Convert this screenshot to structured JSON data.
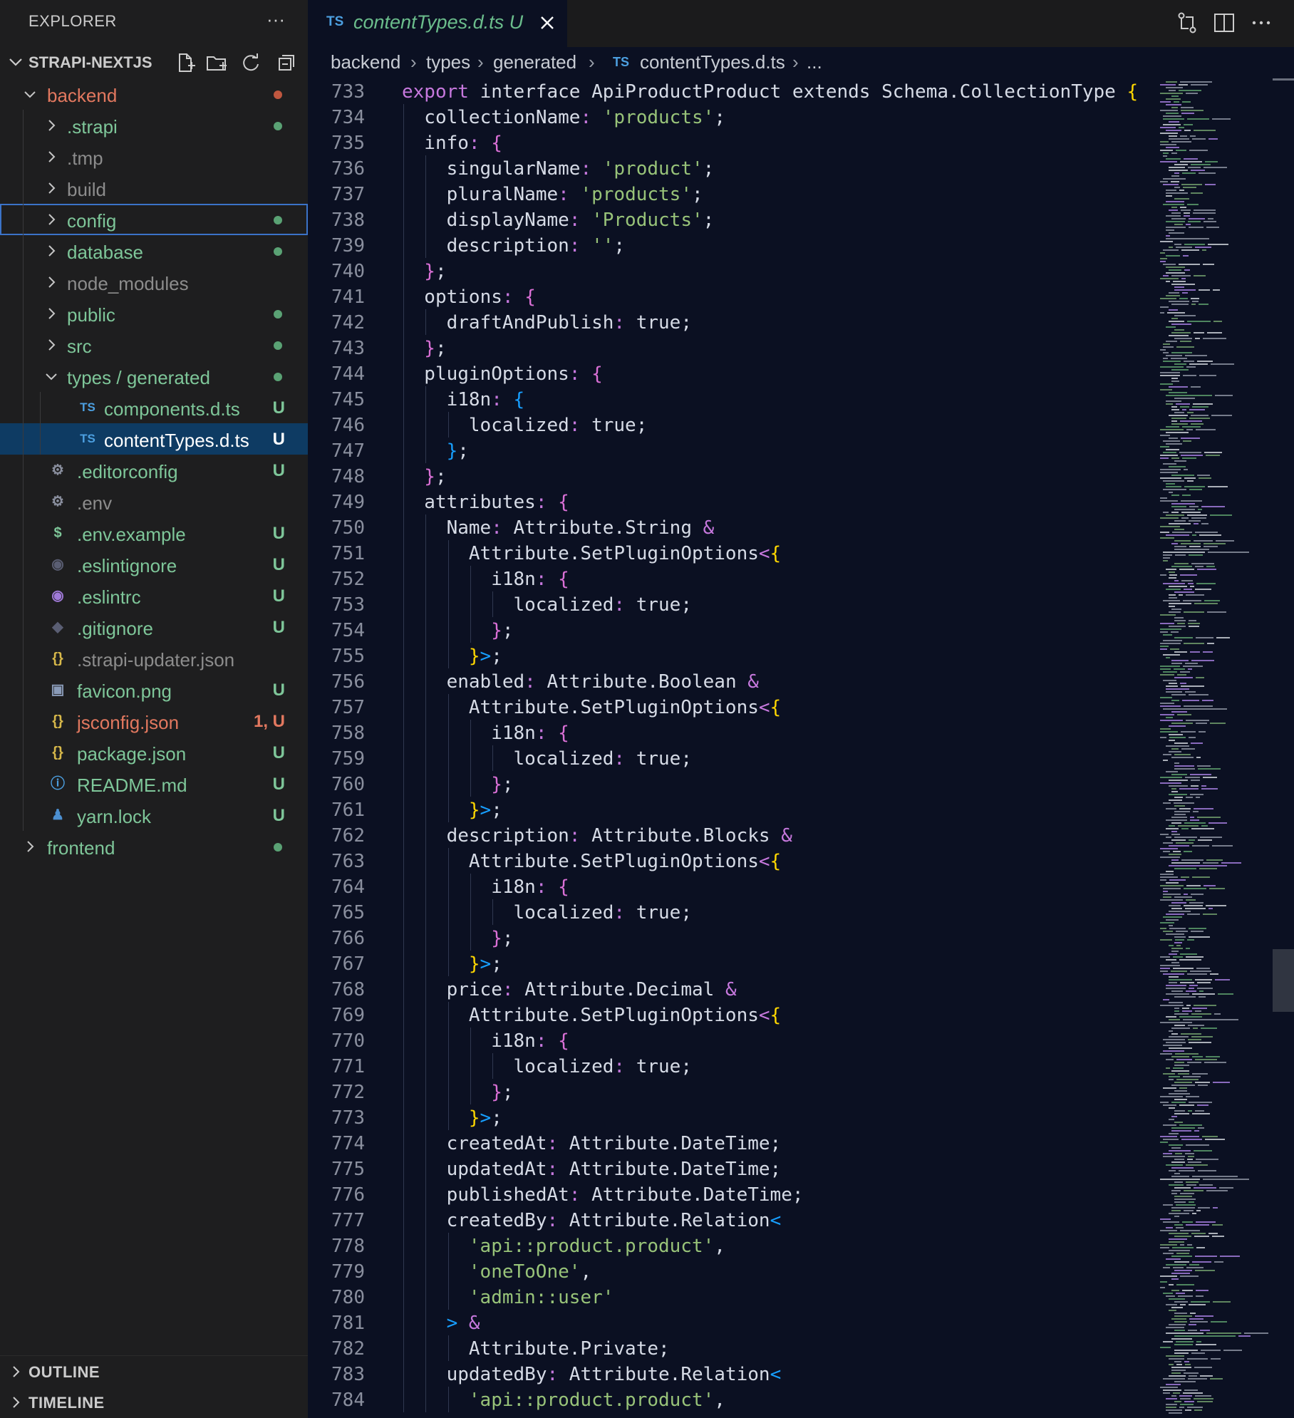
{
  "explorer": {
    "title": "EXPLORER",
    "more": "···",
    "project": "STRAPI-NEXTJS",
    "actions": [
      "new-file-icon",
      "new-folder-icon",
      "refresh-icon",
      "collapse-all-icon"
    ],
    "items": [
      {
        "label": "backend",
        "type": "folder",
        "open": true,
        "depth": 0,
        "color": "#e2785f",
        "status": "dot",
        "status_color": "#c0573f"
      },
      {
        "label": ".strapi",
        "type": "folder",
        "depth": 1,
        "color": "#7ec699",
        "status": "dot",
        "status_color": "#5aa274"
      },
      {
        "label": ".tmp",
        "type": "folder",
        "depth": 1,
        "color": "#8c8c8c",
        "status": ""
      },
      {
        "label": "build",
        "type": "folder",
        "depth": 1,
        "color": "#8c8c8c",
        "status": ""
      },
      {
        "label": "config",
        "type": "folder",
        "depth": 1,
        "color": "#7ec699",
        "status": "dot",
        "status_color": "#5aa274",
        "focused": true
      },
      {
        "label": "database",
        "type": "folder",
        "depth": 1,
        "color": "#7ec699",
        "status": "dot",
        "status_color": "#5aa274"
      },
      {
        "label": "node_modules",
        "type": "folder",
        "depth": 1,
        "color": "#8c8c8c",
        "status": ""
      },
      {
        "label": "public",
        "type": "folder",
        "depth": 1,
        "color": "#7ec699",
        "status": "dot",
        "status_color": "#5aa274"
      },
      {
        "label": "src",
        "type": "folder",
        "depth": 1,
        "color": "#7ec699",
        "status": "dot",
        "status_color": "#5aa274"
      },
      {
        "label": "types / generated",
        "type": "folder",
        "open": true,
        "depth": 1,
        "color": "#7ec699",
        "status": "dot",
        "status_color": "#5aa274"
      },
      {
        "label": "components.d.ts",
        "type": "file",
        "icon": "TS",
        "icon_name": "typescript-file-icon",
        "icon_color": "#4c9fe0",
        "depth": 2,
        "color": "#7ec699",
        "status": "U",
        "status_color": "#7ec699"
      },
      {
        "label": "contentTypes.d.ts",
        "type": "file",
        "icon": "TS",
        "icon_name": "typescript-file-icon",
        "icon_color": "#4c9fe0",
        "depth": 2,
        "color": "#ffffff",
        "status": "U",
        "status_color": "#ffffff",
        "selected": true
      },
      {
        "label": ".editorconfig",
        "type": "file",
        "icon": "⚙",
        "icon_name": "gear-icon",
        "icon_color": "#8a8f9e",
        "depth": 1,
        "color": "#7ec699",
        "status": "U",
        "status_color": "#7ec699"
      },
      {
        "label": ".env",
        "type": "file",
        "icon": "⚙",
        "icon_name": "gear-icon",
        "icon_color": "#8a8f9e",
        "depth": 1,
        "color": "#8c8c8c",
        "status": ""
      },
      {
        "label": ".env.example",
        "type": "file",
        "icon": "$",
        "icon_name": "dollar-icon",
        "icon_color": "#7ec699",
        "depth": 1,
        "color": "#7ec699",
        "status": "U",
        "status_color": "#7ec699"
      },
      {
        "label": ".eslintignore",
        "type": "file",
        "icon": "◉",
        "icon_name": "eslint-icon",
        "icon_color": "#5a5e73",
        "depth": 1,
        "color": "#7ec699",
        "status": "U",
        "status_color": "#7ec699"
      },
      {
        "label": ".eslintrc",
        "type": "file",
        "icon": "◉",
        "icon_name": "eslint-icon",
        "icon_color": "#a07ad8",
        "depth": 1,
        "color": "#7ec699",
        "status": "U",
        "status_color": "#7ec699"
      },
      {
        "label": ".gitignore",
        "type": "file",
        "icon": "◆",
        "icon_name": "git-icon",
        "icon_color": "#5a5e73",
        "depth": 1,
        "color": "#7ec699",
        "status": "U",
        "status_color": "#7ec699"
      },
      {
        "label": ".strapi-updater.json",
        "type": "file",
        "icon": "{}",
        "icon_name": "json-icon",
        "icon_color": "#d7b84a",
        "depth": 1,
        "color": "#8c8c8c",
        "status": ""
      },
      {
        "label": "favicon.png",
        "type": "file",
        "icon": "▣",
        "icon_name": "image-icon",
        "icon_color": "#8a9bb8",
        "depth": 1,
        "color": "#7ec699",
        "status": "U",
        "status_color": "#7ec699"
      },
      {
        "label": "jsconfig.json",
        "type": "file",
        "icon": "{}",
        "icon_name": "json-icon",
        "icon_color": "#d7b84a",
        "depth": 1,
        "color": "#e2785f",
        "status": "1, U",
        "status_color": "#e2785f"
      },
      {
        "label": "package.json",
        "type": "file",
        "icon": "{}",
        "icon_name": "json-icon",
        "icon_color": "#d7b84a",
        "depth": 1,
        "color": "#7ec699",
        "status": "U",
        "status_color": "#7ec699"
      },
      {
        "label": "README.md",
        "type": "file",
        "icon": "ⓘ",
        "icon_name": "info-icon",
        "icon_color": "#4c9fe0",
        "depth": 1,
        "color": "#7ec699",
        "status": "U",
        "status_color": "#7ec699"
      },
      {
        "label": "yarn.lock",
        "type": "file",
        "icon": "♟",
        "icon_name": "yarn-icon",
        "icon_color": "#4c8fd0",
        "depth": 1,
        "color": "#7ec699",
        "status": "U",
        "status_color": "#7ec699"
      },
      {
        "label": "frontend",
        "type": "folder",
        "depth": 0,
        "color": "#7ec699",
        "status": "dot",
        "status_color": "#5aa274"
      }
    ],
    "outline": "OUTLINE",
    "timeline": "TIMELINE"
  },
  "tab": {
    "ts_badge": "TS",
    "name": "contentTypes.d.ts",
    "status": "U"
  },
  "breadcrumbs": [
    "backend",
    "types",
    "generated",
    "contentTypes.d.ts",
    "..."
  ],
  "breadcrumb_ts_badge": "TS",
  "code": {
    "lines": [
      {
        "n": "733",
        "i": 0,
        "t": [
          [
            "export ",
            "k"
          ],
          [
            "interface ApiProductProduct extends Schema.CollectionType ",
            ""
          ],
          [
            "{",
            "b1"
          ]
        ]
      },
      {
        "n": "734",
        "i": 1,
        "t": [
          [
            "collectionName",
            ""
          ],
          [
            ": ",
            "k"
          ],
          [
            "'products'",
            "s"
          ],
          [
            ";",
            ""
          ]
        ]
      },
      {
        "n": "735",
        "i": 1,
        "t": [
          [
            "info",
            ""
          ],
          [
            ": ",
            "k"
          ],
          [
            "{",
            "b2"
          ]
        ]
      },
      {
        "n": "736",
        "i": 2,
        "t": [
          [
            "singularName",
            ""
          ],
          [
            ": ",
            "k"
          ],
          [
            "'product'",
            "s"
          ],
          [
            ";",
            ""
          ]
        ]
      },
      {
        "n": "737",
        "i": 2,
        "t": [
          [
            "pluralName",
            ""
          ],
          [
            ": ",
            "k"
          ],
          [
            "'products'",
            "s"
          ],
          [
            ";",
            ""
          ]
        ]
      },
      {
        "n": "738",
        "i": 2,
        "t": [
          [
            "displayName",
            ""
          ],
          [
            ": ",
            "k"
          ],
          [
            "'Products'",
            "s"
          ],
          [
            ";",
            ""
          ]
        ]
      },
      {
        "n": "739",
        "i": 2,
        "t": [
          [
            "description",
            ""
          ],
          [
            ": ",
            "k"
          ],
          [
            "''",
            "s"
          ],
          [
            ";",
            ""
          ]
        ]
      },
      {
        "n": "740",
        "i": 1,
        "t": [
          [
            "}",
            "b2"
          ],
          [
            ";",
            ""
          ]
        ]
      },
      {
        "n": "741",
        "i": 1,
        "t": [
          [
            "options",
            ""
          ],
          [
            ": ",
            "k"
          ],
          [
            "{",
            "b2"
          ]
        ]
      },
      {
        "n": "742",
        "i": 2,
        "t": [
          [
            "draftAndPublish",
            ""
          ],
          [
            ": ",
            "k"
          ],
          [
            "true;",
            ""
          ]
        ]
      },
      {
        "n": "743",
        "i": 1,
        "t": [
          [
            "}",
            "b2"
          ],
          [
            ";",
            ""
          ]
        ]
      },
      {
        "n": "744",
        "i": 1,
        "t": [
          [
            "pluginOptions",
            ""
          ],
          [
            ": ",
            "k"
          ],
          [
            "{",
            "b2"
          ]
        ]
      },
      {
        "n": "745",
        "i": 2,
        "t": [
          [
            "i18n",
            ""
          ],
          [
            ": ",
            "k"
          ],
          [
            "{",
            "b3"
          ]
        ]
      },
      {
        "n": "746",
        "i": 3,
        "t": [
          [
            "localized",
            ""
          ],
          [
            ": ",
            "k"
          ],
          [
            "true;",
            ""
          ]
        ]
      },
      {
        "n": "747",
        "i": 2,
        "t": [
          [
            "}",
            "b3"
          ],
          [
            ";",
            ""
          ]
        ]
      },
      {
        "n": "748",
        "i": 1,
        "t": [
          [
            "}",
            "b2"
          ],
          [
            ";",
            ""
          ]
        ]
      },
      {
        "n": "749",
        "i": 1,
        "t": [
          [
            "attributes",
            ""
          ],
          [
            ": ",
            "k"
          ],
          [
            "{",
            "b2"
          ]
        ]
      },
      {
        "n": "750",
        "i": 2,
        "t": [
          [
            "Name",
            ""
          ],
          [
            ": ",
            "k"
          ],
          [
            "Attribute.String ",
            ""
          ],
          [
            "&",
            "k"
          ]
        ]
      },
      {
        "n": "751",
        "i": 3,
        "t": [
          [
            "Attribute.SetPluginOptions",
            ""
          ],
          [
            "<",
            "k"
          ],
          [
            "{",
            "b1"
          ]
        ]
      },
      {
        "n": "752",
        "i": 4,
        "t": [
          [
            "i18n",
            ""
          ],
          [
            ": ",
            "k"
          ],
          [
            "{",
            "b2"
          ]
        ]
      },
      {
        "n": "753",
        "i": 5,
        "t": [
          [
            "localized",
            ""
          ],
          [
            ": ",
            "k"
          ],
          [
            "true;",
            ""
          ]
        ]
      },
      {
        "n": "754",
        "i": 4,
        "t": [
          [
            "}",
            "b2"
          ],
          [
            ";",
            ""
          ]
        ]
      },
      {
        "n": "755",
        "i": 3,
        "t": [
          [
            "}",
            "b1"
          ],
          [
            ">",
            "b3"
          ],
          [
            ";",
            ""
          ]
        ]
      },
      {
        "n": "756",
        "i": 2,
        "t": [
          [
            "enabled",
            ""
          ],
          [
            ": ",
            "k"
          ],
          [
            "Attribute.Boolean ",
            ""
          ],
          [
            "&",
            "k"
          ]
        ]
      },
      {
        "n": "757",
        "i": 3,
        "t": [
          [
            "Attribute.SetPluginOptions",
            ""
          ],
          [
            "<",
            "k"
          ],
          [
            "{",
            "b1"
          ]
        ]
      },
      {
        "n": "758",
        "i": 4,
        "t": [
          [
            "i18n",
            ""
          ],
          [
            ": ",
            "k"
          ],
          [
            "{",
            "b2"
          ]
        ]
      },
      {
        "n": "759",
        "i": 5,
        "t": [
          [
            "localized",
            ""
          ],
          [
            ": ",
            "k"
          ],
          [
            "true;",
            ""
          ]
        ]
      },
      {
        "n": "760",
        "i": 4,
        "t": [
          [
            "}",
            "b2"
          ],
          [
            ";",
            ""
          ]
        ]
      },
      {
        "n": "761",
        "i": 3,
        "t": [
          [
            "}",
            "b1"
          ],
          [
            ">",
            "b3"
          ],
          [
            ";",
            ""
          ]
        ]
      },
      {
        "n": "762",
        "i": 2,
        "t": [
          [
            "description",
            ""
          ],
          [
            ": ",
            "k"
          ],
          [
            "Attribute.Blocks ",
            ""
          ],
          [
            "&",
            "k"
          ]
        ]
      },
      {
        "n": "763",
        "i": 3,
        "t": [
          [
            "Attribute.SetPluginOptions",
            ""
          ],
          [
            "<",
            "k"
          ],
          [
            "{",
            "b1"
          ]
        ]
      },
      {
        "n": "764",
        "i": 4,
        "t": [
          [
            "i18n",
            ""
          ],
          [
            ": ",
            "k"
          ],
          [
            "{",
            "b2"
          ]
        ]
      },
      {
        "n": "765",
        "i": 5,
        "t": [
          [
            "localized",
            ""
          ],
          [
            ": ",
            "k"
          ],
          [
            "true;",
            ""
          ]
        ]
      },
      {
        "n": "766",
        "i": 4,
        "t": [
          [
            "}",
            "b2"
          ],
          [
            ";",
            ""
          ]
        ]
      },
      {
        "n": "767",
        "i": 3,
        "t": [
          [
            "}",
            "b1"
          ],
          [
            ">",
            "b3"
          ],
          [
            ";",
            ""
          ]
        ]
      },
      {
        "n": "768",
        "i": 2,
        "t": [
          [
            "price",
            ""
          ],
          [
            ": ",
            "k"
          ],
          [
            "Attribute.Decimal ",
            ""
          ],
          [
            "&",
            "k"
          ]
        ]
      },
      {
        "n": "769",
        "i": 3,
        "t": [
          [
            "Attribute.SetPluginOptions",
            ""
          ],
          [
            "<",
            "k"
          ],
          [
            "{",
            "b1"
          ]
        ]
      },
      {
        "n": "770",
        "i": 4,
        "t": [
          [
            "i18n",
            ""
          ],
          [
            ": ",
            "k"
          ],
          [
            "{",
            "b2"
          ]
        ]
      },
      {
        "n": "771",
        "i": 5,
        "t": [
          [
            "localized",
            ""
          ],
          [
            ": ",
            "k"
          ],
          [
            "true;",
            ""
          ]
        ]
      },
      {
        "n": "772",
        "i": 4,
        "t": [
          [
            "}",
            "b2"
          ],
          [
            ";",
            ""
          ]
        ]
      },
      {
        "n": "773",
        "i": 3,
        "t": [
          [
            "}",
            "b1"
          ],
          [
            ">",
            "b3"
          ],
          [
            ";",
            ""
          ]
        ]
      },
      {
        "n": "774",
        "i": 2,
        "t": [
          [
            "createdAt",
            ""
          ],
          [
            ": ",
            "k"
          ],
          [
            "Attribute.DateTime;",
            ""
          ]
        ]
      },
      {
        "n": "775",
        "i": 2,
        "t": [
          [
            "updatedAt",
            ""
          ],
          [
            ": ",
            "k"
          ],
          [
            "Attribute.DateTime;",
            ""
          ]
        ]
      },
      {
        "n": "776",
        "i": 2,
        "t": [
          [
            "publishedAt",
            ""
          ],
          [
            ": ",
            "k"
          ],
          [
            "Attribute.DateTime;",
            ""
          ]
        ]
      },
      {
        "n": "777",
        "i": 2,
        "t": [
          [
            "createdBy",
            ""
          ],
          [
            ": ",
            "k"
          ],
          [
            "Attribute.Relation",
            ""
          ],
          [
            "<",
            "b3"
          ]
        ]
      },
      {
        "n": "778",
        "i": 3,
        "t": [
          [
            "'api::product.product'",
            "s"
          ],
          [
            ",",
            ""
          ]
        ]
      },
      {
        "n": "779",
        "i": 3,
        "t": [
          [
            "'oneToOne'",
            "s"
          ],
          [
            ",",
            ""
          ]
        ]
      },
      {
        "n": "780",
        "i": 3,
        "t": [
          [
            "'admin::user'",
            "s"
          ]
        ]
      },
      {
        "n": "781",
        "i": 2,
        "t": [
          [
            ">",
            "b3"
          ],
          [
            " &",
            "k"
          ]
        ]
      },
      {
        "n": "782",
        "i": 3,
        "t": [
          [
            "Attribute.Private;",
            ""
          ]
        ]
      },
      {
        "n": "783",
        "i": 2,
        "t": [
          [
            "updatedBy",
            ""
          ],
          [
            ": ",
            "k"
          ],
          [
            "Attribute.Relation",
            ""
          ],
          [
            "<",
            "b3"
          ]
        ]
      },
      {
        "n": "784",
        "i": 3,
        "t": [
          [
            "'api::product.product'",
            "s"
          ],
          [
            ",",
            ""
          ]
        ]
      }
    ]
  },
  "scroll": {
    "thumb_top_fraction": 0.65,
    "thumb_height_fraction": 0.047
  },
  "colors": {
    "accent": "#3b73c8",
    "git_untracked": "#7ec699",
    "git_modified": "#e2785f",
    "editor_bg": "#0b1022",
    "sidebar_bg": "#1e1e1f"
  }
}
